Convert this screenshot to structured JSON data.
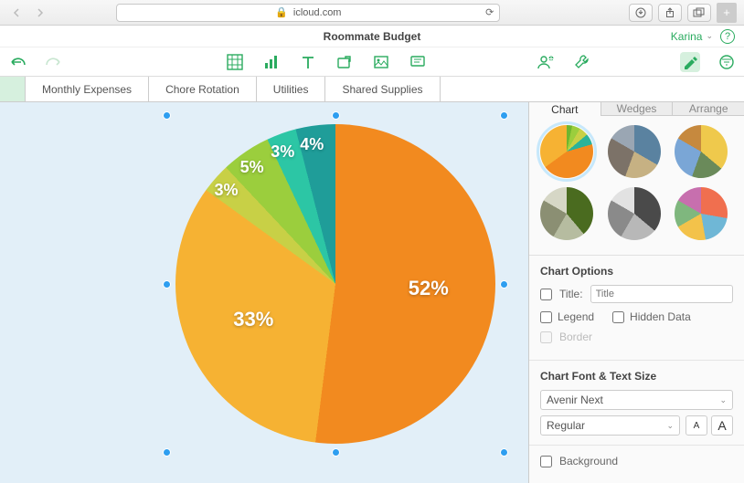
{
  "browser": {
    "url": "icloud.com"
  },
  "document": {
    "title": "Roommate Budget",
    "user": "Karina"
  },
  "sheetTabs": [
    "Monthly Expenses",
    "Chore Rotation",
    "Utilities",
    "Shared Supplies"
  ],
  "inspector": {
    "tabs": [
      "Chart",
      "Wedges",
      "Arrange"
    ],
    "styleSwatches": [
      "conic-gradient(#6fb62f 0 12deg,#9bce3d 12deg 30deg,#c8d046 30deg 50deg,#2bb39a 50deg 74deg,#f28a1f 74deg 234deg,#f6b233 234deg 360deg)",
      "conic-gradient(#5a82a0 0 120deg,#c6b183 120deg 200deg,#7c7268 200deg 300deg,#9aa6b3 300deg 360deg)",
      "conic-gradient(#efc94c 0 130deg,#6a8a5a 130deg 200deg,#7aa6d6 200deg 300deg,#c6893e 300deg 360deg)",
      "conic-gradient(#4a6b1f 0 140deg,#b6bca0 140deg 210deg,#8b8f73 210deg 300deg,#d6d7c6 300deg 360deg)",
      "conic-gradient(#4a4a4a 0 130deg,#b8b8b8 130deg 210deg,#8a8a8a 210deg 300deg,#e2e2e2 300deg 360deg)",
      "conic-gradient(#f06f4f 0 100deg,#6fb7d6 100deg 170deg,#f3c24a 170deg 240deg,#7fb77e 240deg 300deg,#c76fae 300deg 360deg)"
    ],
    "chartOptions": {
      "heading": "Chart Options",
      "titleLabel": "Title:",
      "titlePlaceholder": "Title",
      "legendLabel": "Legend",
      "hiddenLabel": "Hidden Data",
      "borderLabel": "Border"
    },
    "fontSection": {
      "heading": "Chart Font & Text Size",
      "font": "Avenir Next",
      "style": "Regular"
    },
    "backgroundLabel": "Background"
  },
  "chart_data": {
    "type": "pie",
    "title": "",
    "values": [
      52,
      33,
      3,
      5,
      3,
      4
    ],
    "labels": [
      "52%",
      "33%",
      "3%",
      "5%",
      "3%",
      "4%"
    ],
    "colors": [
      "#f28a1f",
      "#f6b233",
      "#c8d046",
      "#9bce3d",
      "#2cc6a5",
      "#1f9d99"
    ]
  }
}
